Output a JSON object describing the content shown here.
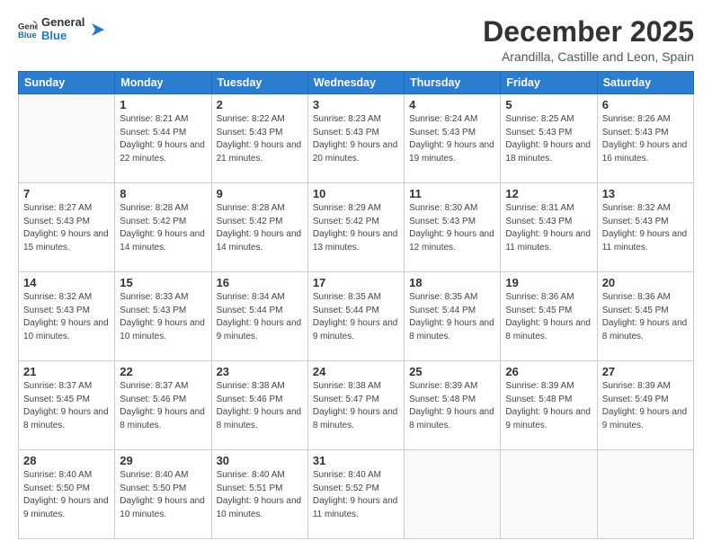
{
  "logo": {
    "line1": "General",
    "line2": "Blue"
  },
  "title": "December 2025",
  "subtitle": "Arandilla, Castille and Leon, Spain",
  "weekdays": [
    "Sunday",
    "Monday",
    "Tuesday",
    "Wednesday",
    "Thursday",
    "Friday",
    "Saturday"
  ],
  "weeks": [
    [
      {
        "day": "",
        "empty": true
      },
      {
        "day": "1",
        "sunrise": "8:21 AM",
        "sunset": "5:44 PM",
        "daylight": "9 hours and 22 minutes."
      },
      {
        "day": "2",
        "sunrise": "8:22 AM",
        "sunset": "5:43 PM",
        "daylight": "9 hours and 21 minutes."
      },
      {
        "day": "3",
        "sunrise": "8:23 AM",
        "sunset": "5:43 PM",
        "daylight": "9 hours and 20 minutes."
      },
      {
        "day": "4",
        "sunrise": "8:24 AM",
        "sunset": "5:43 PM",
        "daylight": "9 hours and 19 minutes."
      },
      {
        "day": "5",
        "sunrise": "8:25 AM",
        "sunset": "5:43 PM",
        "daylight": "9 hours and 18 minutes."
      },
      {
        "day": "6",
        "sunrise": "8:26 AM",
        "sunset": "5:43 PM",
        "daylight": "9 hours and 16 minutes."
      }
    ],
    [
      {
        "day": "7",
        "sunrise": "8:27 AM",
        "sunset": "5:43 PM",
        "daylight": "9 hours and 15 minutes."
      },
      {
        "day": "8",
        "sunrise": "8:28 AM",
        "sunset": "5:42 PM",
        "daylight": "9 hours and 14 minutes."
      },
      {
        "day": "9",
        "sunrise": "8:28 AM",
        "sunset": "5:42 PM",
        "daylight": "9 hours and 14 minutes."
      },
      {
        "day": "10",
        "sunrise": "8:29 AM",
        "sunset": "5:42 PM",
        "daylight": "9 hours and 13 minutes."
      },
      {
        "day": "11",
        "sunrise": "8:30 AM",
        "sunset": "5:43 PM",
        "daylight": "9 hours and 12 minutes."
      },
      {
        "day": "12",
        "sunrise": "8:31 AM",
        "sunset": "5:43 PM",
        "daylight": "9 hours and 11 minutes."
      },
      {
        "day": "13",
        "sunrise": "8:32 AM",
        "sunset": "5:43 PM",
        "daylight": "9 hours and 11 minutes."
      }
    ],
    [
      {
        "day": "14",
        "sunrise": "8:32 AM",
        "sunset": "5:43 PM",
        "daylight": "9 hours and 10 minutes."
      },
      {
        "day": "15",
        "sunrise": "8:33 AM",
        "sunset": "5:43 PM",
        "daylight": "9 hours and 10 minutes."
      },
      {
        "day": "16",
        "sunrise": "8:34 AM",
        "sunset": "5:44 PM",
        "daylight": "9 hours and 9 minutes."
      },
      {
        "day": "17",
        "sunrise": "8:35 AM",
        "sunset": "5:44 PM",
        "daylight": "9 hours and 9 minutes."
      },
      {
        "day": "18",
        "sunrise": "8:35 AM",
        "sunset": "5:44 PM",
        "daylight": "9 hours and 8 minutes."
      },
      {
        "day": "19",
        "sunrise": "8:36 AM",
        "sunset": "5:45 PM",
        "daylight": "9 hours and 8 minutes."
      },
      {
        "day": "20",
        "sunrise": "8:36 AM",
        "sunset": "5:45 PM",
        "daylight": "9 hours and 8 minutes."
      }
    ],
    [
      {
        "day": "21",
        "sunrise": "8:37 AM",
        "sunset": "5:45 PM",
        "daylight": "9 hours and 8 minutes."
      },
      {
        "day": "22",
        "sunrise": "8:37 AM",
        "sunset": "5:46 PM",
        "daylight": "9 hours and 8 minutes."
      },
      {
        "day": "23",
        "sunrise": "8:38 AM",
        "sunset": "5:46 PM",
        "daylight": "9 hours and 8 minutes."
      },
      {
        "day": "24",
        "sunrise": "8:38 AM",
        "sunset": "5:47 PM",
        "daylight": "9 hours and 8 minutes."
      },
      {
        "day": "25",
        "sunrise": "8:39 AM",
        "sunset": "5:48 PM",
        "daylight": "9 hours and 8 minutes."
      },
      {
        "day": "26",
        "sunrise": "8:39 AM",
        "sunset": "5:48 PM",
        "daylight": "9 hours and 9 minutes."
      },
      {
        "day": "27",
        "sunrise": "8:39 AM",
        "sunset": "5:49 PM",
        "daylight": "9 hours and 9 minutes."
      }
    ],
    [
      {
        "day": "28",
        "sunrise": "8:40 AM",
        "sunset": "5:50 PM",
        "daylight": "9 hours and 9 minutes."
      },
      {
        "day": "29",
        "sunrise": "8:40 AM",
        "sunset": "5:50 PM",
        "daylight": "9 hours and 10 minutes."
      },
      {
        "day": "30",
        "sunrise": "8:40 AM",
        "sunset": "5:51 PM",
        "daylight": "9 hours and 10 minutes."
      },
      {
        "day": "31",
        "sunrise": "8:40 AM",
        "sunset": "5:52 PM",
        "daylight": "9 hours and 11 minutes."
      },
      {
        "day": "",
        "empty": true
      },
      {
        "day": "",
        "empty": true
      },
      {
        "day": "",
        "empty": true
      }
    ]
  ]
}
